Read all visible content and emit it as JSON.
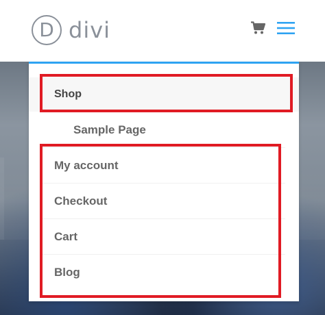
{
  "header": {
    "logo_letter": "D",
    "logo_text": "divi",
    "cart_icon": "cart-icon",
    "menu_icon": "hamburger-menu-icon",
    "accent_color": "#2ea3f2"
  },
  "menu": {
    "items": [
      {
        "label": "Shop",
        "active": true
      },
      {
        "label": "Sample Page",
        "submenu": true
      },
      {
        "label": "My account"
      },
      {
        "label": "Checkout"
      },
      {
        "label": "Cart"
      },
      {
        "label": "Blog"
      }
    ]
  },
  "annotations": {
    "highlight_color": "#e01b24"
  }
}
